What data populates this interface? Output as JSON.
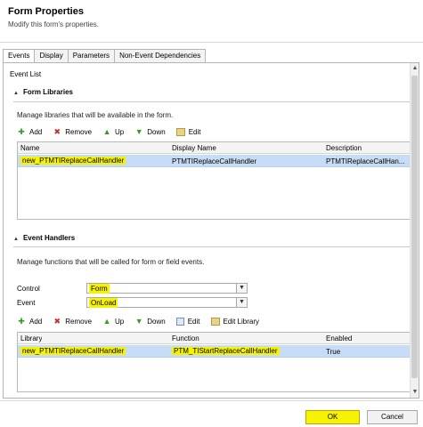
{
  "header": {
    "title": "Form Properties",
    "subtitle": "Modify this form's properties."
  },
  "tabs": [
    {
      "label": "Events",
      "active": true
    },
    {
      "label": "Display",
      "active": false
    },
    {
      "label": "Parameters",
      "active": false
    },
    {
      "label": "Non-Event Dependencies",
      "active": false
    }
  ],
  "event_list_label": "Event List",
  "form_libraries": {
    "title": "Form Libraries",
    "description": "Manage libraries that will be available in the form.",
    "toolbar": {
      "add": "Add",
      "remove": "Remove",
      "up": "Up",
      "down": "Down",
      "edit": "Edit"
    },
    "columns": {
      "name": "Name",
      "display_name": "Display Name",
      "description": "Description"
    },
    "rows": [
      {
        "name": "new_PTMTIReplaceCallHandler",
        "display_name": "PTMTIReplaceCallHandler",
        "description": "PTMTIReplaceCallHan..."
      }
    ]
  },
  "event_handlers": {
    "title": "Event Handlers",
    "description": "Manage functions that will be called for form or field events.",
    "control_label": "Control",
    "control_value": "Form",
    "event_label": "Event",
    "event_value": "OnLoad",
    "toolbar": {
      "add": "Add",
      "remove": "Remove",
      "up": "Up",
      "down": "Down",
      "edit": "Edit",
      "edit_library": "Edit Library"
    },
    "columns": {
      "library": "Library",
      "function": "Function",
      "enabled": "Enabled"
    },
    "rows": [
      {
        "library": "new_PTMTIReplaceCallHandler",
        "function": "PTM_TIStartReplaceCallHandler",
        "enabled": "True"
      }
    ]
  },
  "footer": {
    "ok": "OK",
    "cancel": "Cancel"
  },
  "colors": {
    "highlight": "#f6f200",
    "row_selected": "#c7ddf6"
  }
}
